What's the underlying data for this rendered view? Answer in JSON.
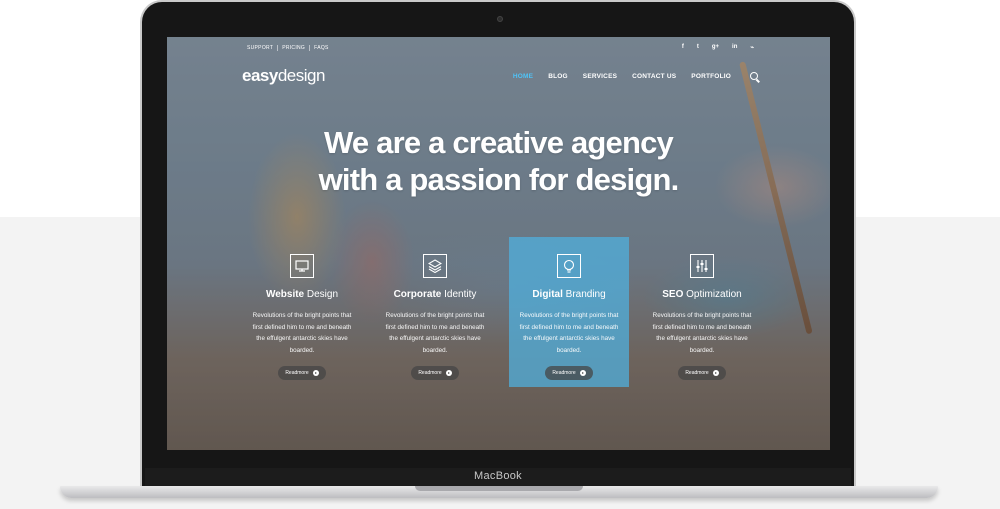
{
  "device": {
    "label": "MacBook"
  },
  "site": {
    "topbar": [
      "SUPPORT",
      "PRICING",
      "FAQS"
    ],
    "social": [
      {
        "glyph": "f",
        "name": "facebook-icon"
      },
      {
        "glyph": "t",
        "name": "twitter-icon"
      },
      {
        "glyph": "g+",
        "name": "google-plus-icon"
      },
      {
        "glyph": "in",
        "name": "linkedin-icon"
      },
      {
        "glyph": "⌁",
        "name": "rss-icon"
      }
    ],
    "logo": {
      "bold": "easy",
      "light": "design"
    },
    "nav": [
      {
        "label": "HOME",
        "active": true
      },
      {
        "label": "BLOG",
        "active": false
      },
      {
        "label": "SERVICES",
        "active": false
      },
      {
        "label": "CONTACT US",
        "active": false
      },
      {
        "label": "PORTFOLIO",
        "active": false
      }
    ],
    "hero": {
      "line1": "We are a creative agency",
      "line2": "with a passion for design."
    },
    "features": [
      {
        "strong": "Website",
        "rest": " Design",
        "icon": "monitor-icon",
        "highlight": false,
        "text": "Revolutions of the bright points that first defined him to me and beneath the effulgent antarctic skies have boarded.",
        "button": "Readmore"
      },
      {
        "strong": "Corporate",
        "rest": " Identity",
        "icon": "layers-icon",
        "highlight": false,
        "text": "Revolutions of the bright points that first defined him to me and beneath the effulgent antarctic skies have boarded.",
        "button": "Readmore"
      },
      {
        "strong": "Digital",
        "rest": " Branding",
        "icon": "lightbulb-icon",
        "highlight": true,
        "text": "Revolutions of the bright points that first defined him to me and beneath the effulgent antarctic skies have boarded.",
        "button": "Readmore"
      },
      {
        "strong": "SEO",
        "rest": " Optimization",
        "icon": "sliders-icon",
        "highlight": false,
        "text": "Revolutions of the bright points that first defined him to me and beneath the effulgent antarctic skies have boarded.",
        "button": "Readmore"
      }
    ]
  }
}
